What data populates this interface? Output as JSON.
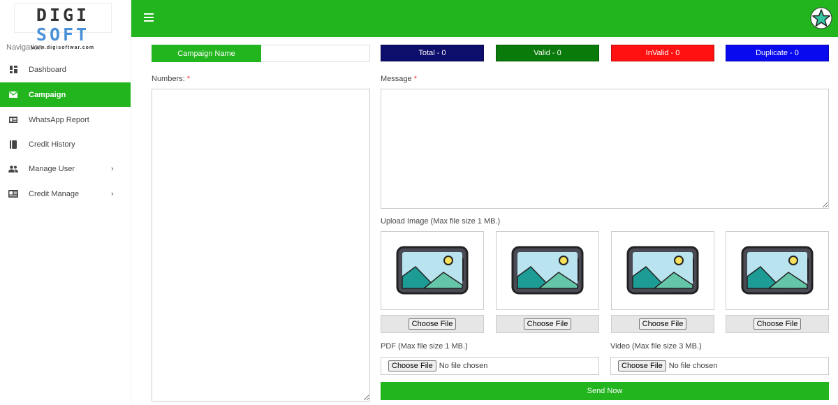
{
  "logo": {
    "letters_a": "DIGI",
    "letters_b": "SOFT",
    "url": "www.digisoftwar.com"
  },
  "navigation": {
    "heading": "Navigation",
    "items": [
      {
        "label": "Dashboard",
        "icon": "dashboard-icon"
      },
      {
        "label": "Campaign",
        "icon": "mail-icon",
        "active": true
      },
      {
        "label": "WhatsApp Report",
        "icon": "report-icon"
      },
      {
        "label": "Credit History",
        "icon": "book-icon"
      },
      {
        "label": "Manage User",
        "icon": "users-icon",
        "has_submenu": true
      },
      {
        "label": "Credit Manage",
        "icon": "card-icon",
        "has_submenu": true
      }
    ]
  },
  "colors": {
    "brand_green": "#22b51e",
    "total": "#0d0d6b",
    "valid": "#0a7a0a",
    "invalid": "#ff1111",
    "duplicate": "#0a0aee"
  },
  "campaign": {
    "label": "Campaign Name",
    "value": "",
    "placeholder": ""
  },
  "stats": {
    "total": "Total - 0",
    "valid": "Valid - 0",
    "invalid": "InValid - 0",
    "duplicate": "Duplicate - 0"
  },
  "numbers": {
    "label": "Numbers:",
    "required": "*",
    "value": ""
  },
  "message": {
    "label": "Message",
    "required": "*",
    "value": ""
  },
  "upload_image": {
    "label": "Upload Image (Max file size 1 MB.)",
    "button": "Choose File"
  },
  "pdf": {
    "label": "PDF (Max file size 1 MB.)",
    "button": "Choose File",
    "status": "No file chosen"
  },
  "video": {
    "label": "Video (Max file size 3 MB.)",
    "button": "Choose File",
    "status": "No file chosen"
  },
  "send_button": "Send Now"
}
